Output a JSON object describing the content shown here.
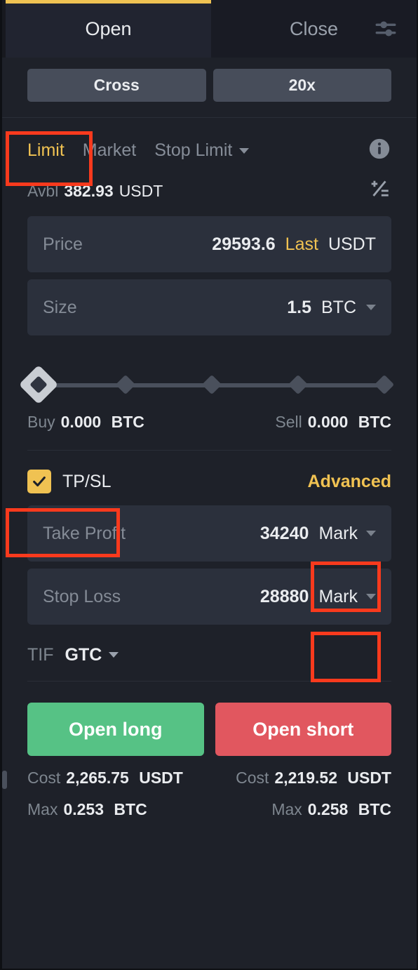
{
  "tabs": {
    "open_label": "Open",
    "close_label": "Close",
    "settings_icon": "sliders-icon"
  },
  "mode": {
    "margin_label": "Cross",
    "leverage_label": "20x"
  },
  "order_types": {
    "items": [
      {
        "label": "Limit",
        "active": true
      },
      {
        "label": "Market",
        "active": false
      },
      {
        "label": "Stop Limit",
        "active": false
      }
    ],
    "info_icon": "info-icon"
  },
  "available": {
    "label": "Avbl",
    "value": "382.93",
    "unit": "USDT",
    "icon": "transfer-calculator-icon"
  },
  "price_field": {
    "label": "Price",
    "value": "29593.6",
    "mode_label": "Last",
    "unit": "USDT"
  },
  "size_field": {
    "label": "Size",
    "value": "1.5",
    "unit": "BTC",
    "caret_icon": "chevron-down-icon"
  },
  "slider": {
    "positions": [
      0,
      25,
      50,
      75,
      100
    ],
    "current": 0
  },
  "amounts": {
    "buy_label": "Buy",
    "buy_value": "0.000",
    "buy_unit": "BTC",
    "sell_label": "Sell",
    "sell_value": "0.000",
    "sell_unit": "BTC"
  },
  "tpsl": {
    "checked": true,
    "label": "TP/SL",
    "advanced_label": "Advanced",
    "take_profit": {
      "label": "Take Profit",
      "value": "34240",
      "trigger": "Mark"
    },
    "stop_loss": {
      "label": "Stop Loss",
      "value": "28880",
      "trigger": "Mark"
    }
  },
  "tif": {
    "label": "TIF",
    "value": "GTC"
  },
  "actions": {
    "long_label": "Open long",
    "short_label": "Open short",
    "long_cost_label": "Cost",
    "long_cost_value": "2,265.75",
    "long_cost_unit": "USDT",
    "long_max_label": "Max",
    "long_max_value": "0.253",
    "long_max_unit": "BTC",
    "short_cost_label": "Cost",
    "short_cost_value": "2,219.52",
    "short_cost_unit": "USDT",
    "short_max_label": "Max",
    "short_max_value": "0.258",
    "short_max_unit": "BTC"
  },
  "colors": {
    "accent": "#F0C252",
    "long": "#56C285",
    "short": "#E1575F",
    "annotation": "#F93A1D",
    "panel_bg": "#1E2129",
    "field_bg": "#2B303C"
  }
}
